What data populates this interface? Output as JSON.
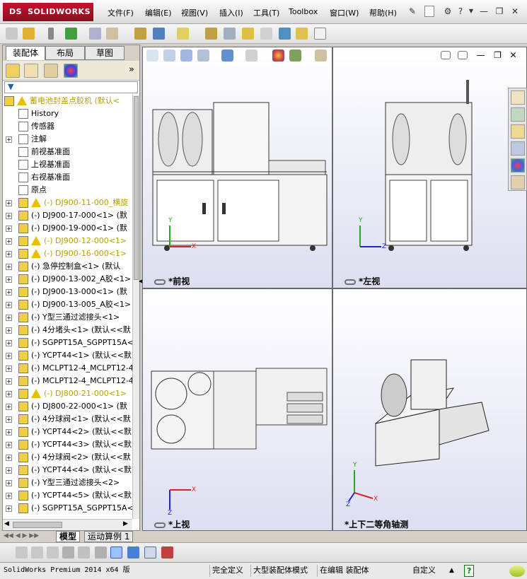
{
  "app": {
    "logo_text": "SOLIDWORKS",
    "logo_prefix": "DS"
  },
  "menu": [
    "文件(F)",
    "编辑(E)",
    "视图(V)",
    "插入(I)",
    "工具(T)",
    "Toolbox",
    "窗口(W)",
    "帮助(H)"
  ],
  "panel_tabs": [
    "装配体",
    "布局",
    "草图"
  ],
  "tree": {
    "root": "蓄电池封盖点胶机  (默认<",
    "fixed_items": [
      "History",
      "传感器",
      "注解",
      "前视基准面",
      "上视基准面",
      "右视基准面",
      "原点"
    ],
    "components": [
      {
        "label": "(-) DJ900-11-000_横旋",
        "warn": true
      },
      {
        "label": "(-) DJ900-17-000<1>  (默",
        "warn": false
      },
      {
        "label": "(-) DJ900-19-000<1>  (默",
        "warn": false
      },
      {
        "label": "(-) DJ900-12-000<1>",
        "warn": true
      },
      {
        "label": "(-) DJ900-16-000<1>",
        "warn": true
      },
      {
        "label": "(-) 急停控制盒<1>  (默认",
        "warn": false
      },
      {
        "label": "(-) DJ900-13-002_A胶<1>",
        "warn": false
      },
      {
        "label": "(-) DJ900-13-000<1>  (默",
        "warn": false
      },
      {
        "label": "(-) DJ900-13-005_A胶<1>",
        "warn": false
      },
      {
        "label": "(-) Y型三通过滤接头<1>",
        "warn": false
      },
      {
        "label": "(-) 4分堵头<1>  (默认<<默",
        "warn": false
      },
      {
        "label": "(-) SGPPT15A_SGPPT15A<1",
        "warn": false
      },
      {
        "label": "(-) YCPT44<1>  (默认<<默",
        "warn": false
      },
      {
        "label": "(-) MCLPT12-4_MCLPT12-4",
        "warn": false
      },
      {
        "label": "(-) MCLPT12-4_MCLPT12-4",
        "warn": false
      },
      {
        "label": "(-) DJ800-21-000<1>",
        "warn": true
      },
      {
        "label": "(-) DJ800-22-000<1>  (默",
        "warn": false
      },
      {
        "label": "(-) 4分球阀<1>  (默认<<默",
        "warn": false
      },
      {
        "label": "(-) YCPT44<2>  (默认<<默",
        "warn": false
      },
      {
        "label": "(-) YCPT44<3>  (默认<<默",
        "warn": false
      },
      {
        "label": "(-) 4分球阀<2>  (默认<<默",
        "warn": false
      },
      {
        "label": "(-) YCPT44<4>  (默认<<默",
        "warn": false
      },
      {
        "label": "(-) Y型三通过滤接头<2>",
        "warn": false
      },
      {
        "label": "(-) YCPT44<5>  (默认<<默",
        "warn": false
      },
      {
        "label": "(-) SGPPT15A_SGPPT15A<2",
        "warn": false
      }
    ]
  },
  "bottom_tabs": [
    "模型",
    "运动算例 1"
  ],
  "views": {
    "front": "*前视",
    "left": "*左视",
    "top": "*上视",
    "iso": "*上下二等角轴测"
  },
  "axes": {
    "x": "X",
    "y": "Y",
    "z": "Z"
  },
  "status": {
    "version": "SolidWorks Premium 2014 x64 版",
    "defined": "完全定义",
    "mode": "大型装配体模式",
    "editing": "在编辑 装配体",
    "units": "自定义",
    "help": "?"
  },
  "colors": {
    "brand": "#c8102e",
    "warning": "#e8c000",
    "viewport_bg": "#dcdff0"
  }
}
